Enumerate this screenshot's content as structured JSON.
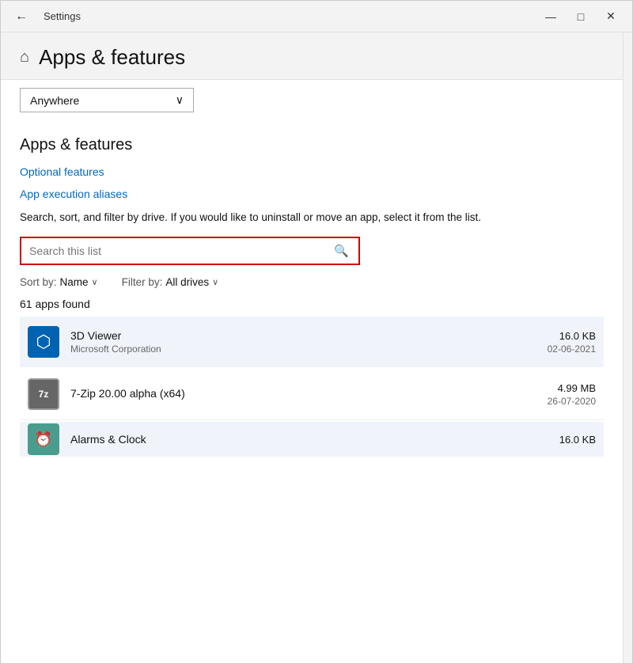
{
  "window": {
    "title": "Settings",
    "back_label": "←",
    "controls": {
      "minimize": "—",
      "maximize": "□",
      "close": "✕"
    }
  },
  "header": {
    "icon": "⌂",
    "title": "Apps & features"
  },
  "filter_dropdown": {
    "label": "Anywhere",
    "chevron": "∨"
  },
  "section": {
    "title": "Apps & features",
    "optional_features_label": "Optional features",
    "app_execution_aliases_label": "App execution aliases",
    "description": "Search, sort, and filter by drive. If you would like to uninstall or move an app, select it from the list."
  },
  "search": {
    "placeholder": "Search this list",
    "icon": "🔍"
  },
  "sort": {
    "label": "Sort by:",
    "value": "Name",
    "chevron": "∨"
  },
  "filter": {
    "label": "Filter by:",
    "value": "All drives",
    "chevron": "∨"
  },
  "apps_count": "61 apps found",
  "apps": [
    {
      "name": "3D Viewer",
      "publisher": "Microsoft Corporation",
      "size": "16.0 KB",
      "date": "02-06-2021",
      "icon_type": "blue",
      "icon_char": "⬡"
    },
    {
      "name": "7-Zip 20.00 alpha (x64)",
      "publisher": "",
      "size": "4.99 MB",
      "date": "26-07-2020",
      "icon_type": "gray",
      "icon_char": "7z"
    },
    {
      "name": "Alarms & Clock",
      "publisher": "",
      "size": "16.0 KB",
      "date": "",
      "icon_type": "teal",
      "icon_char": "⏰"
    }
  ]
}
